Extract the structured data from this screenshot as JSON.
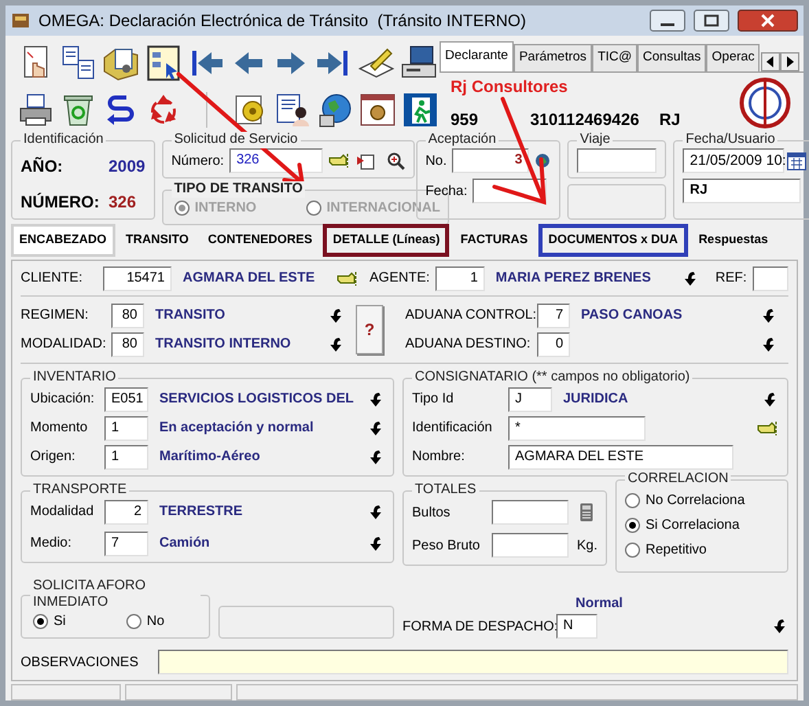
{
  "window": {
    "title": "OMEGA: Declaración Electrónica de Tránsito  (Tránsito INTERNO)"
  },
  "top_tabs": [
    {
      "label": "Declarante",
      "selected": true
    },
    {
      "label": "Parámetros",
      "selected": false
    },
    {
      "label": "TIC@",
      "selected": false
    },
    {
      "label": "Consultas",
      "selected": false
    },
    {
      "label": "Operac",
      "selected": false
    }
  ],
  "company": {
    "name": "Rj Consultores",
    "code": "959",
    "id": "310112469426",
    "initials": "RJ"
  },
  "identificacion": {
    "title": "Identificación",
    "ano_label": "AÑO:",
    "ano": "2009",
    "numero_label": "NÚMERO:",
    "numero": "326"
  },
  "solicitud": {
    "title": "Solicitud de Servicio",
    "numero_label": "Número:",
    "numero": "326"
  },
  "tipo_transito": {
    "title": "TIPO DE TRANSITO",
    "disabled": true,
    "options": [
      {
        "label": "INTERNO",
        "selected": true
      },
      {
        "label": "INTERNACIONAL",
        "selected": false
      }
    ]
  },
  "aceptacion": {
    "title": "Aceptación",
    "no_label": "No.",
    "no": "3",
    "fecha_label": "Fecha:"
  },
  "viaje": {
    "title": "Viaje"
  },
  "fecha_usuario": {
    "title": "Fecha/Usuario",
    "fecha": "21/05/2009 10:",
    "usuario": "RJ"
  },
  "tabs": [
    {
      "label": "ENCABEZADO",
      "selected": true
    },
    {
      "label": "TRANSITO",
      "selected": false
    },
    {
      "label": "CONTENEDORES",
      "selected": false
    },
    {
      "label": "DETALLE (Líneas)",
      "selected": false,
      "color": "#7a1020"
    },
    {
      "label": "FACTURAS",
      "selected": false
    },
    {
      "label": "DOCUMENTOS x DUA",
      "selected": false,
      "color": "#3040b8"
    },
    {
      "label": "Respuestas",
      "selected": false
    }
  ],
  "cliente": {
    "label": "CLIENTE:",
    "value": "15471",
    "description": "AGMARA DEL ESTE"
  },
  "agente": {
    "label": "AGENTE:",
    "value": "1",
    "description": "MARIA PEREZ BRENES"
  },
  "ref": {
    "label": "REF:"
  },
  "regimen_fields": [
    {
      "label": "REGIMEN:",
      "value": "80",
      "description": "TRANSITO"
    },
    {
      "label": "MODALIDAD:",
      "value": "80",
      "description": "TRANSITO INTERNO"
    }
  ],
  "help_button": {
    "label": "?"
  },
  "aduana_fields": [
    {
      "label": "ADUANA CONTROL:",
      "value": "7",
      "description": "PASO CANOAS"
    },
    {
      "label": "ADUANA DESTINO:",
      "value": "0"
    }
  ],
  "inventario": {
    "title": "INVENTARIO",
    "fields": [
      {
        "label": "Ubicación:",
        "value": "E051",
        "description": "SERVICIOS LOGISTICOS DEL"
      },
      {
        "label": "Momento",
        "value": "1",
        "description": "En aceptación y normal"
      },
      {
        "label": "Origen:",
        "value": "1",
        "description": "Marítimo-Aéreo"
      }
    ]
  },
  "consignatario": {
    "title": "CONSIGNATARIO (** campos no obligatorio)",
    "fields": [
      {
        "label": "Tipo Id",
        "value": "J",
        "description": "JURIDICA"
      },
      {
        "label": "Identificación",
        "value": "*"
      },
      {
        "label": "Nombre:",
        "value": "AGMARA DEL ESTE"
      }
    ]
  },
  "transporte": {
    "title": "TRANSPORTE",
    "fields": [
      {
        "label": "Modalidad",
        "value": "2",
        "description": "TERRESTRE"
      },
      {
        "label": "Medio:",
        "value": "7",
        "description": "Camión"
      }
    ]
  },
  "totales": {
    "title": "TOTALES",
    "fields": [
      {
        "label": "Bultos"
      },
      {
        "label": "Peso Bruto",
        "unit": "Kg."
      }
    ]
  },
  "correlacion": {
    "title": "CORRELACION",
    "options": [
      {
        "label": "No Correlaciona",
        "selected": false
      },
      {
        "label": "Si Correlaciona",
        "selected": true
      },
      {
        "label": "Repetitivo",
        "selected": false
      }
    ]
  },
  "aforo": {
    "title": "SOLICITA AFORO INMEDIATO",
    "options": [
      {
        "label": "Si",
        "selected": true
      },
      {
        "label": "No",
        "selected": false
      }
    ]
  },
  "despacho": {
    "label": "FORMA DE DESPACHO:",
    "value": "N",
    "description": "Normal"
  },
  "observaciones": {
    "label": "OBSERVACIONES"
  }
}
